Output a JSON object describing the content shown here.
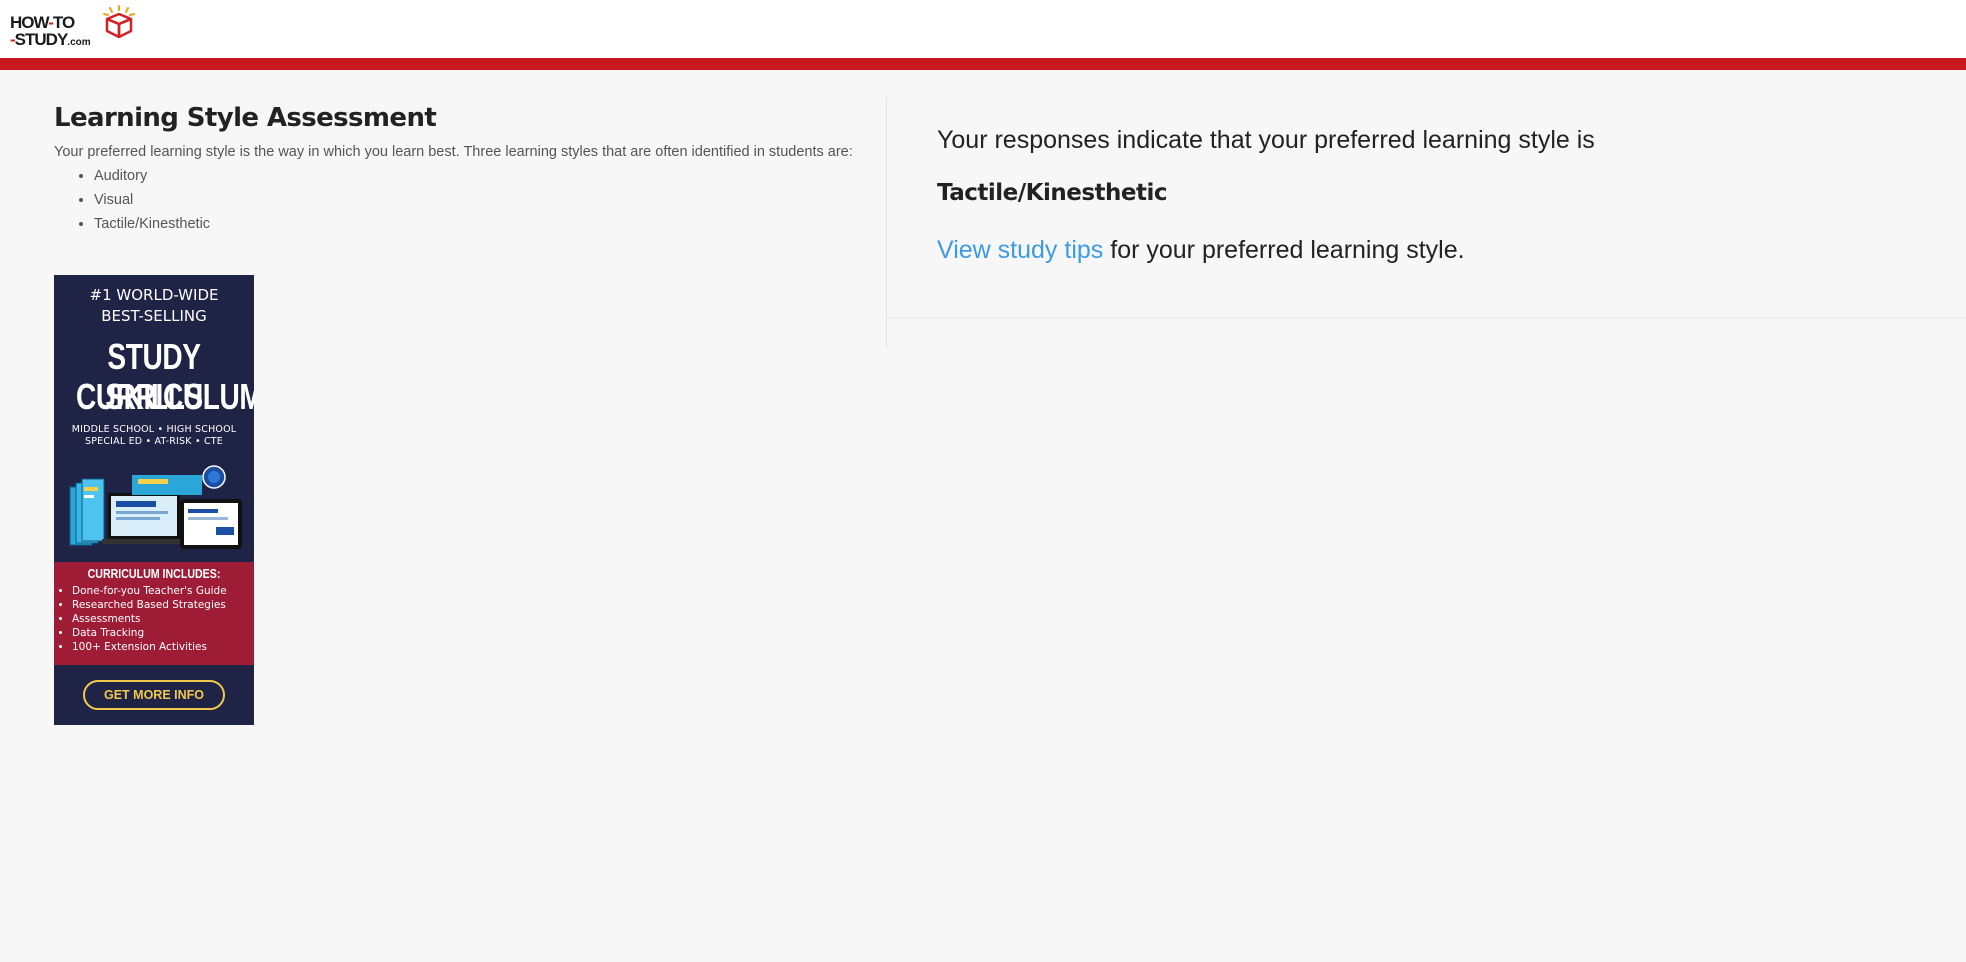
{
  "header": {
    "logo": {
      "line1_part1": "HOW",
      "line1_dash": "-",
      "line1_part2": "TO",
      "line2_dash": "-",
      "line2_main": "STUDY",
      "line2_suffix": ".com"
    },
    "bar_color": "#c8181c"
  },
  "assessment": {
    "title": "Learning Style Assessment",
    "intro": "Your preferred learning style is the way in which you learn best. Three learning styles that are often identified in students are:",
    "styles": [
      "Auditory",
      "Visual",
      "Tactile/Kinesthetic"
    ]
  },
  "ad": {
    "top_line1": "#1 WORLD-WIDE",
    "top_line2": "BEST-SELLING",
    "headline1": "STUDY SKILLS",
    "headline2": "CURRICULUM",
    "audience1": "MIDDLE SCHOOL • HIGH SCHOOL",
    "audience2": "SPECIAL ED • AT-RISK • CTE",
    "includes_title": "CURRICULUM INCLUDES:",
    "includes": [
      "Done-for-you Teacher's Guide",
      "Researched Based Strategies",
      "Assessments",
      "Data Tracking",
      "100+ Extension Activities"
    ],
    "button_label": "GET MORE INFO",
    "colors": {
      "background": "#1f2447",
      "includes_band": "#9e1c35",
      "button": "#f2c84b"
    }
  },
  "result": {
    "intro": "Your responses indicate that your preferred learning style is",
    "style": "Tactile/Kinesthetic",
    "tips_link": "View study tips",
    "tips_suffix": " for your preferred learning style.",
    "link_color": "#3c9be6"
  }
}
